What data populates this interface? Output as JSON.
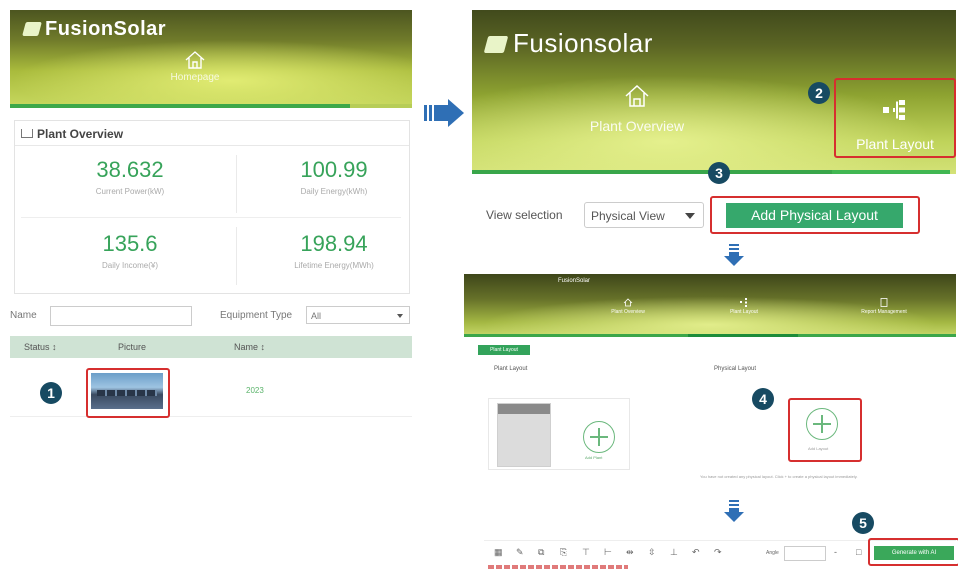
{
  "left_panel": {
    "logo_text": "FusionSolar",
    "tab_label": "Homepage",
    "overview_title": "Plant Overview",
    "kpis": [
      {
        "value": "38.632",
        "label": "Current Power(kW)"
      },
      {
        "value": "100.99",
        "label": "Daily Energy(kWh)"
      },
      {
        "value": "135.6",
        "label": "Daily Income(¥)"
      },
      {
        "value": "198.94",
        "label": "Lifetime Energy(MWh)"
      }
    ],
    "filter": {
      "name_label": "Name",
      "equipment_label": "Equipment Type",
      "equipment_value": "All"
    },
    "table": {
      "columns": [
        "Status ↕",
        "Picture",
        "Name ↕"
      ],
      "rows": [
        {
          "name": "2023"
        }
      ]
    },
    "step": "1"
  },
  "right_top": {
    "logo_text": "Fusionsolar",
    "tab_overview": "Plant Overview",
    "tab_layout": "Plant Layout",
    "view_label": "View selection",
    "view_value": "Physical View",
    "add_button": "Add Physical Layout",
    "steps": [
      "2",
      "3"
    ]
  },
  "mid_shot": {
    "logo_text": "FusionSolar",
    "tabs": [
      "Plant Overview",
      "Plant Layout",
      "Report Management"
    ],
    "mini_button": "Plant Layout",
    "col_plant": "Plant Layout",
    "col_physical": "Physical Layout",
    "add_label": "Add Plant",
    "add_layout_label": "Add Layout",
    "hint": "You have not created any physical layout. Click + to create a physical layout immediately.",
    "step": "4"
  },
  "bottom": {
    "zoom_label": "Angle",
    "generate_button": "Generate with AI",
    "step": "5"
  },
  "colors": {
    "accent_green": "#36a86c",
    "kpi_green": "#37a35a",
    "badge": "#174a62",
    "highlight": "#d62f2f"
  }
}
